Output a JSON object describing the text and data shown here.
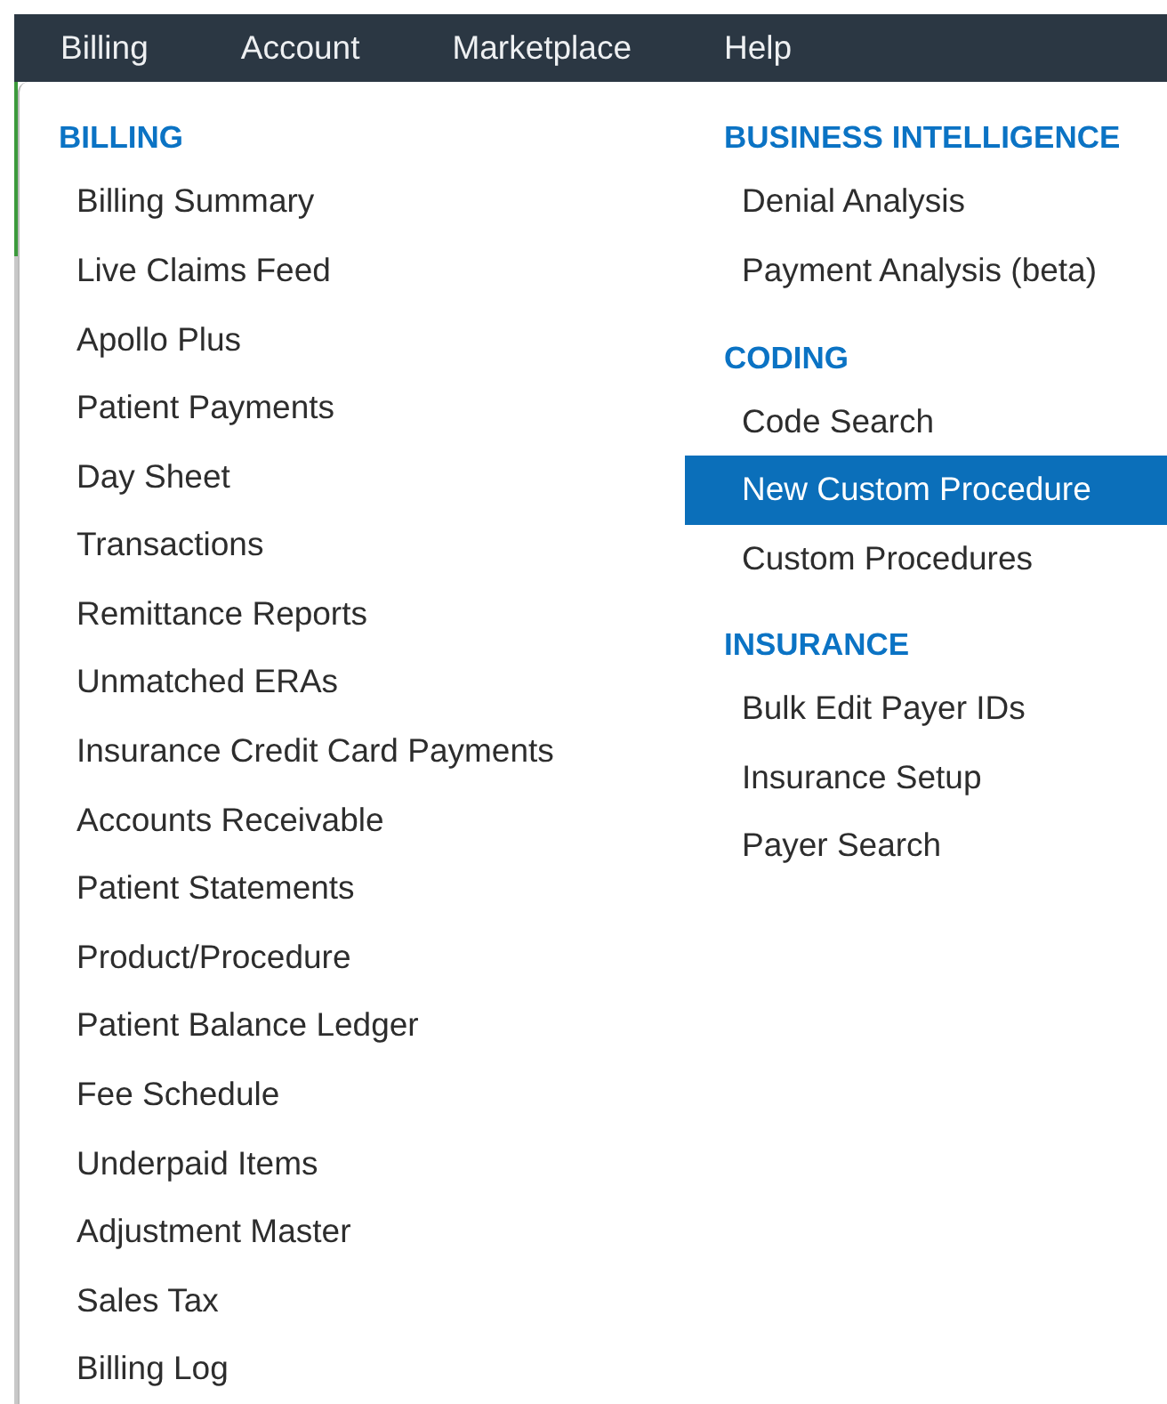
{
  "menu_bar": [
    {
      "label": "Billing"
    },
    {
      "label": "Account"
    },
    {
      "label": "Marketplace"
    },
    {
      "label": "Help"
    }
  ],
  "dropdown": {
    "columns": [
      {
        "sections": [
          {
            "heading": "BILLING",
            "items": [
              {
                "label": "Billing Summary",
                "selected": false
              },
              {
                "label": "Live Claims Feed",
                "selected": false
              },
              {
                "label": "Apollo Plus",
                "selected": false
              },
              {
                "label": "Patient Payments",
                "selected": false
              },
              {
                "label": "Day Sheet",
                "selected": false
              },
              {
                "label": "Transactions",
                "selected": false
              },
              {
                "label": "Remittance Reports",
                "selected": false
              },
              {
                "label": "Unmatched ERAs",
                "selected": false
              },
              {
                "label": "Insurance Credit Card Payments",
                "selected": false
              },
              {
                "label": "Accounts Receivable",
                "selected": false
              },
              {
                "label": "Patient Statements",
                "selected": false
              },
              {
                "label": "Product/Procedure",
                "selected": false
              },
              {
                "label": "Patient Balance Ledger",
                "selected": false
              },
              {
                "label": "Fee Schedule",
                "selected": false
              },
              {
                "label": "Underpaid Items",
                "selected": false
              },
              {
                "label": "Adjustment Master",
                "selected": false
              },
              {
                "label": "Sales Tax",
                "selected": false
              },
              {
                "label": "Billing Log",
                "selected": false
              }
            ]
          }
        ]
      },
      {
        "sections": [
          {
            "heading": "BUSINESS INTELLIGENCE",
            "items": [
              {
                "label": "Denial Analysis",
                "selected": false
              },
              {
                "label": "Payment Analysis (beta)",
                "selected": false
              }
            ]
          },
          {
            "heading": "CODING",
            "items": [
              {
                "label": "Code Search",
                "selected": false
              },
              {
                "label": "New Custom Procedure",
                "selected": true
              },
              {
                "label": "Custom Procedures",
                "selected": false
              }
            ]
          },
          {
            "heading": "INSURANCE",
            "items": [
              {
                "label": "Bulk Edit Payer IDs",
                "selected": false
              },
              {
                "label": "Insurance Setup",
                "selected": false
              },
              {
                "label": "Payer Search",
                "selected": false
              }
            ]
          }
        ]
      }
    ]
  }
}
